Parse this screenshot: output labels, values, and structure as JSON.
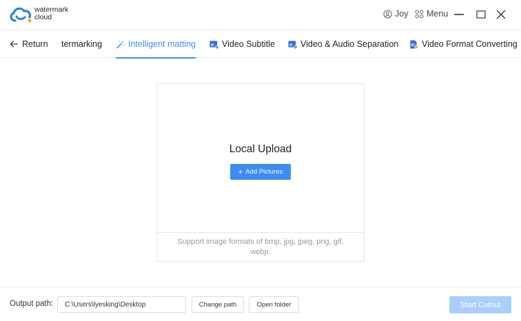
{
  "app": {
    "logo_line1": "watermark",
    "logo_line2": "cloud",
    "brand_color": "#3f8cf0"
  },
  "header": {
    "user_name": "Joy",
    "menu_label": "Menu",
    "icons": [
      "user-icon",
      "menu-grid-icon",
      "minimize-icon",
      "maximize-icon",
      "close-icon"
    ]
  },
  "nav": {
    "back_label": "Return",
    "tabs": [
      {
        "label": "termarking",
        "icon": "none",
        "active": false
      },
      {
        "label": "Intelligent matting",
        "icon": "magic-wand-icon",
        "active": true
      },
      {
        "label": "Video Subtitle",
        "icon": "video-subtitle-icon",
        "active": false
      },
      {
        "label": "Video & Audio Separation",
        "icon": "video-audio-icon",
        "active": false
      },
      {
        "label": "Video Format Converting",
        "icon": "video-format-icon",
        "active": false
      }
    ]
  },
  "upload": {
    "title": "Local Upload",
    "add_button": "Add Pictures",
    "hint": "Support image formats of bmp, jpg, jpeg, png, gif, webp."
  },
  "footer": {
    "output_label": "Output path:",
    "output_path": "C:\\Users\\lyesking\\Desktop",
    "change_path": "Change path",
    "open_folder": "Open folder",
    "start": "Start Cutout",
    "start_color": "#a9d0fb"
  }
}
